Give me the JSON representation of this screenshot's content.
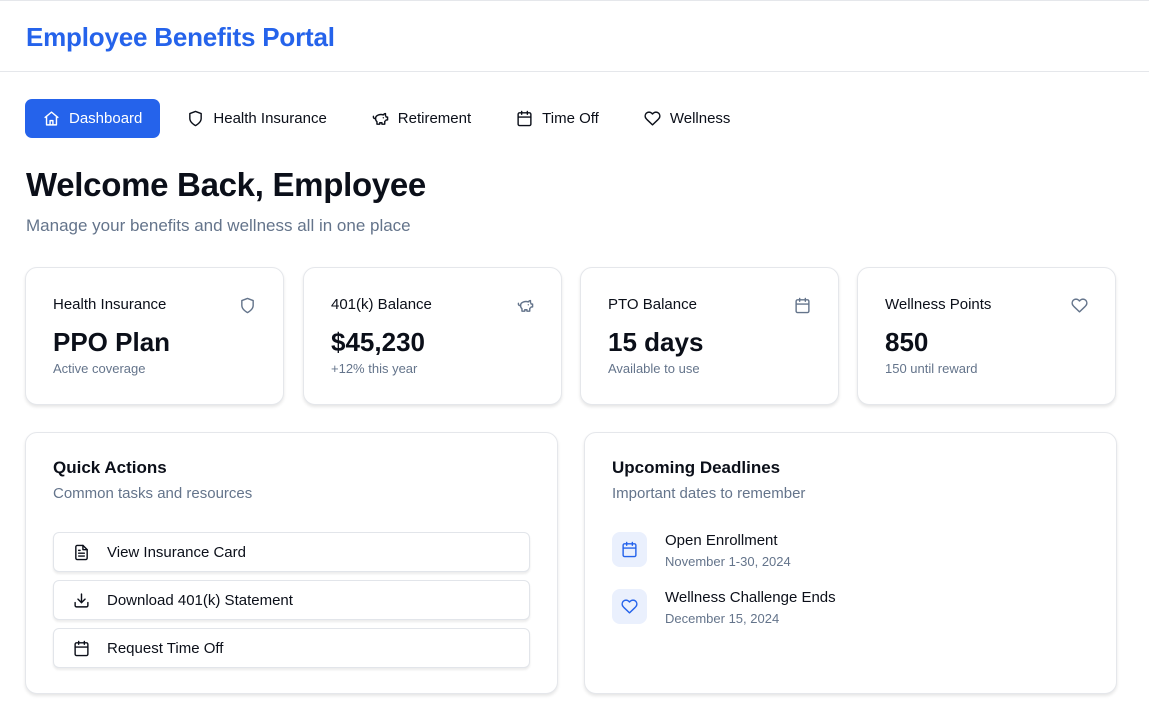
{
  "header": {
    "title": "Employee Benefits Portal"
  },
  "nav": {
    "items": [
      {
        "label": "Dashboard",
        "icon": "home-icon",
        "active": true
      },
      {
        "label": "Health Insurance",
        "icon": "shield-icon",
        "active": false
      },
      {
        "label": "Retirement",
        "icon": "piggy-bank-icon",
        "active": false
      },
      {
        "label": "Time Off",
        "icon": "calendar-icon",
        "active": false
      },
      {
        "label": "Wellness",
        "icon": "heart-icon",
        "active": false
      }
    ]
  },
  "page": {
    "title": "Welcome Back, Employee",
    "subtitle": "Manage your benefits and wellness all in one place"
  },
  "stats": [
    {
      "label": "Health Insurance",
      "icon": "shield-icon",
      "value": "PPO Plan",
      "sub": "Active coverage"
    },
    {
      "label": "401(k) Balance",
      "icon": "piggy-bank-icon",
      "value": "$45,230",
      "sub": "+12% this year"
    },
    {
      "label": "PTO Balance",
      "icon": "calendar-icon",
      "value": "15 days",
      "sub": "Available to use"
    },
    {
      "label": "Wellness Points",
      "icon": "heart-icon",
      "value": "850",
      "sub": "150 until reward"
    }
  ],
  "quick_actions": {
    "title": "Quick Actions",
    "subtitle": "Common tasks and resources",
    "items": [
      {
        "label": "View Insurance Card",
        "icon": "file-text-icon"
      },
      {
        "label": "Download 401(k) Statement",
        "icon": "download-icon"
      },
      {
        "label": "Request Time Off",
        "icon": "calendar-icon"
      }
    ]
  },
  "deadlines": {
    "title": "Upcoming Deadlines",
    "subtitle": "Important dates to remember",
    "items": [
      {
        "title": "Open Enrollment",
        "date": "November 1-30, 2024",
        "icon": "calendar-icon"
      },
      {
        "title": "Wellness Challenge Ends",
        "date": "December 15, 2024",
        "icon": "heart-icon"
      }
    ]
  },
  "colors": {
    "accent": "#2563eb",
    "muted_text": "#64748b",
    "icon_bg": "#eaf0fd",
    "border": "#e5e7eb"
  }
}
